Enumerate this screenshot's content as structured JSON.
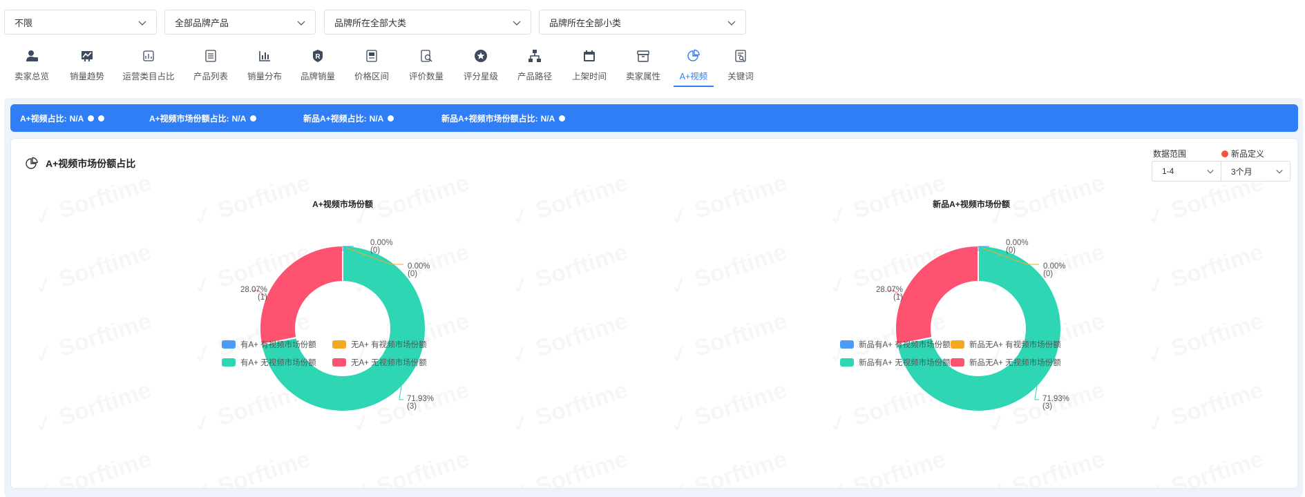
{
  "filters": [
    {
      "value": "不限"
    },
    {
      "value": "全部品牌产品"
    },
    {
      "value": "品牌所在全部大类"
    },
    {
      "value": "品牌所在全部小类"
    }
  ],
  "tabs": [
    {
      "label": "卖家总览",
      "icon": "seller-icon"
    },
    {
      "label": "销量趋势",
      "icon": "trend-icon"
    },
    {
      "label": "运营类目占比",
      "icon": "category-icon"
    },
    {
      "label": "产品列表",
      "icon": "list-icon"
    },
    {
      "label": "销量分布",
      "icon": "bar-chart-icon"
    },
    {
      "label": "品牌销量",
      "icon": "brand-icon"
    },
    {
      "label": "价格区间",
      "icon": "price-icon"
    },
    {
      "label": "评价数量",
      "icon": "review-icon"
    },
    {
      "label": "评分星级",
      "icon": "star-icon"
    },
    {
      "label": "产品路径",
      "icon": "tree-icon"
    },
    {
      "label": "上架时间",
      "icon": "calendar-icon"
    },
    {
      "label": "卖家属性",
      "icon": "box-icon"
    },
    {
      "label": "A+视频",
      "icon": "pie-icon",
      "active": true
    },
    {
      "label": "关键词",
      "icon": "keyword-icon"
    }
  ],
  "stats": [
    {
      "label": "A+视频占比:",
      "value": "N/A"
    },
    {
      "label": "A+视频市场份额占比:",
      "value": "N/A"
    },
    {
      "label": "新品A+视频占比:",
      "value": "N/A"
    },
    {
      "label": "新品A+视频市场份额占比:",
      "value": "N/A"
    }
  ],
  "card": {
    "title": "A+视频市场份额占比",
    "range_label": "数据范围",
    "range_value": "1-4",
    "new_def_label": "新品定义",
    "new_def_value": "3个月"
  },
  "watermark_text": "Sorftime",
  "colors": {
    "blue": "#4a9cf7",
    "orange": "#f7a823",
    "teal": "#2fd6b4",
    "red": "#fd5371",
    "accent": "#2f7ef6"
  },
  "chart_data": [
    {
      "type": "pie",
      "title": "A+视频市场份额",
      "series": [
        {
          "name": "有A+ 有视频市场份额",
          "value": 0.0,
          "label": "0.00%",
          "count": "(0)",
          "color": "#4a9cf7"
        },
        {
          "name": "无A+ 有视频市场份额",
          "value": 0.0,
          "label": "0.00%",
          "count": "(0)",
          "color": "#f7a823"
        },
        {
          "name": "有A+ 无视频市场份额",
          "value": 71.93,
          "label": "71.93%",
          "count": "(3)",
          "color": "#2fd6b4"
        },
        {
          "name": "无A+ 无视频市场份额",
          "value": 28.07,
          "label": "28.07%",
          "count": "(1)",
          "color": "#fd5371"
        }
      ]
    },
    {
      "type": "pie",
      "title": "新品A+视频市场份额",
      "series": [
        {
          "name": "新品有A+ 有视频市场份额",
          "value": 0.0,
          "label": "0.00%",
          "count": "(0)",
          "color": "#4a9cf7"
        },
        {
          "name": "新品无A+ 有视频市场份额",
          "value": 0.0,
          "label": "0.00%",
          "count": "(0)",
          "color": "#f7a823"
        },
        {
          "name": "新品有A+ 无视频市场份额",
          "value": 71.93,
          "label": "71.93%",
          "count": "(3)",
          "color": "#2fd6b4"
        },
        {
          "name": "新品无A+ 无视频市场份额",
          "value": 28.07,
          "label": "28.07%",
          "count": "(1)",
          "color": "#fd5371"
        }
      ]
    }
  ]
}
